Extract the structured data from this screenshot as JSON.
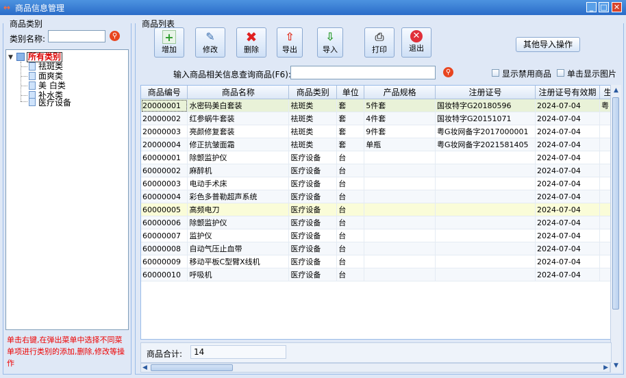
{
  "window": {
    "title": "商品信息管理"
  },
  "left": {
    "group_title": "商品类别",
    "category_name_label": "类别名称:",
    "category_name_value": "",
    "tree": {
      "root": "所有类别",
      "children": [
        "祛斑类",
        "面爽类",
        "美 白类",
        "补水类",
        "医疗设备"
      ]
    },
    "help_text": "单击右键,在弹出菜单中选择不同菜单项进行类别的添加,删除,修改等操作"
  },
  "right": {
    "group_title": "商品列表",
    "toolbar": {
      "add": "增加",
      "edit": "修改",
      "delete": "删除",
      "export": "导出",
      "import": "导入",
      "print": "打印",
      "exit": "退出",
      "other_import": "其他导入操作"
    },
    "search": {
      "label": "输入商品相关信息查询商品(F6):",
      "value": "",
      "show_disabled": "显示禁用商品",
      "click_show_image": "单击显示图片"
    },
    "table": {
      "columns": [
        "商品编号",
        "商品名称",
        "商品类别",
        "单位",
        "产品规格",
        "注册证号",
        "注册证号有效期",
        "生"
      ],
      "rows": [
        [
          "20000001",
          "水密码美白套装",
          "祛斑类",
          "套",
          "5件套",
          "国妆特字G20180596",
          "2024-07-04",
          "粤"
        ],
        [
          "20000002",
          "红参蜗牛套装",
          "祛斑类",
          "套",
          "4件套",
          "国妆特字G20151071",
          "2024-07-04",
          ""
        ],
        [
          "20000003",
          "亮颜修复套装",
          "祛斑类",
          "套",
          "9件套",
          "粤G妆网备字2017000001",
          "2024-07-04",
          ""
        ],
        [
          "20000004",
          "修正抗皱面霜",
          "祛斑类",
          "套",
          "单瓶",
          "粤G妆网备字2021581405",
          "2024-07-04",
          ""
        ],
        [
          "60000001",
          "除颤监护仪",
          "医疗设备",
          "台",
          "",
          "",
          "2024-07-04",
          ""
        ],
        [
          "60000002",
          "麻醉机",
          "医疗设备",
          "台",
          "",
          "",
          "2024-07-04",
          ""
        ],
        [
          "60000003",
          "电动手术床",
          "医疗设备",
          "台",
          "",
          "",
          "2024-07-04",
          ""
        ],
        [
          "60000004",
          "彩色多普勒超声系统",
          "医疗设备",
          "台",
          "",
          "",
          "2024-07-04",
          ""
        ],
        [
          "60000005",
          "高频电刀",
          "医疗设备",
          "台",
          "",
          "",
          "2024-07-04",
          ""
        ],
        [
          "60000006",
          "除颤监护仪",
          "医疗设备",
          "台",
          "",
          "",
          "2024-07-04",
          ""
        ],
        [
          "60000007",
          "监护仪",
          "医疗设备",
          "台",
          "",
          "",
          "2024-07-04",
          ""
        ],
        [
          "60000008",
          "自动气压止血带",
          "医疗设备",
          "台",
          "",
          "",
          "2024-07-04",
          ""
        ],
        [
          "60000009",
          "移动平板C型臂X线机",
          "医疗设备",
          "台",
          "",
          "",
          "2024-07-04",
          ""
        ],
        [
          "60000010",
          "呼吸机",
          "医疗设备",
          "台",
          "",
          "",
          "2024-07-04",
          ""
        ]
      ]
    },
    "footer": {
      "total_label": "商品合计:",
      "total_value": "14"
    }
  }
}
